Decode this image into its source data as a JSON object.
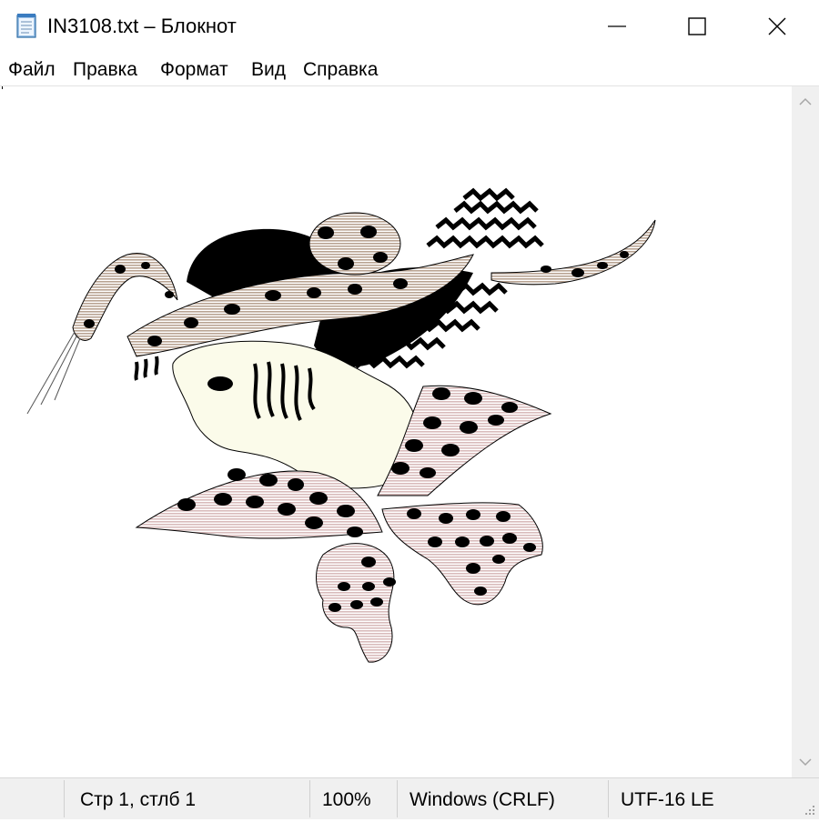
{
  "window": {
    "title": "IN3108.txt – Блокнот"
  },
  "menu": {
    "items": [
      "Файл",
      "Правка",
      "Формат",
      "Вид",
      "Справка"
    ]
  },
  "editor": {
    "content_image": "ascii-art-witch-with-spotted-hat-and-cat"
  },
  "status": {
    "position": "Стр 1, стлб 1",
    "zoom": "100%",
    "line_endings": "Windows (CRLF)",
    "encoding": "UTF-16 LE"
  },
  "icons": {
    "app": "notepad-icon",
    "minimize": "minimize-icon",
    "maximize": "maximize-icon",
    "close": "close-icon",
    "scroll_up": "chevron-up-icon",
    "scroll_down": "chevron-down-icon",
    "grip": "resize-grip-icon"
  },
  "colors": {
    "spot_fill": "#c9b6a5",
    "skin": "#fbfbea",
    "wing_fill": "#e8d2d2",
    "ink": "#000000"
  }
}
